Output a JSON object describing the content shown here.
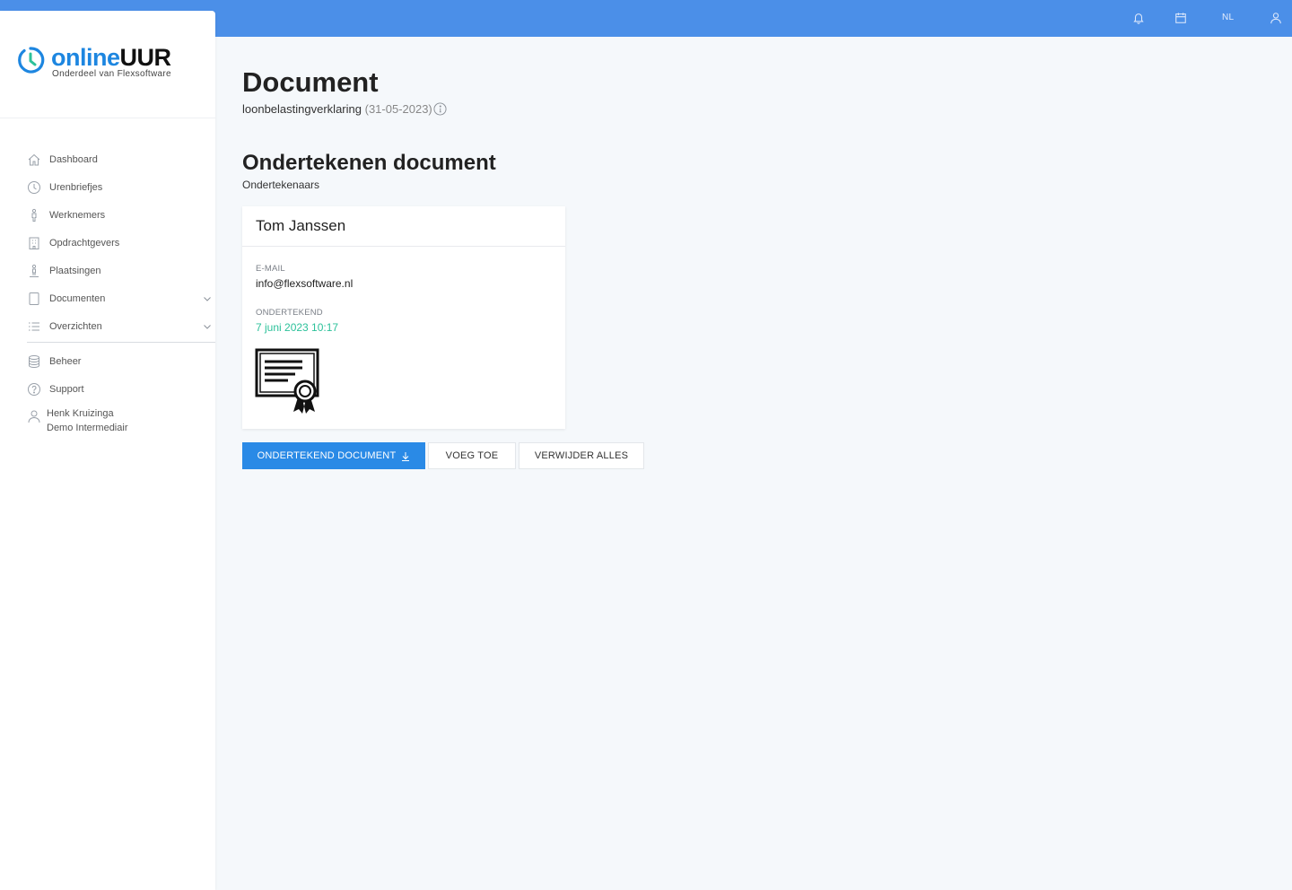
{
  "topbar": {
    "bell_icon": "bell-icon",
    "calendar_icon": "calendar-icon",
    "language": "NL",
    "user_icon": "user-icon",
    "color": "#4b8fe8"
  },
  "brand": {
    "name_part1": "online",
    "name_part2": "UUR",
    "tagline": "Onderdeel van Flexsoftware",
    "accent": "#1d86e0"
  },
  "sidebar": {
    "items": [
      {
        "label": "Dashboard",
        "icon": "home-icon"
      },
      {
        "label": "Urenbriefjes",
        "icon": "clock-icon"
      },
      {
        "label": "Werknemers",
        "icon": "person-icon"
      },
      {
        "label": "Opdrachtgevers",
        "icon": "building-icon"
      },
      {
        "label": "Plaatsingen",
        "icon": "placement-icon"
      },
      {
        "label": "Documenten",
        "icon": "document-icon",
        "expandable": true
      },
      {
        "label": "Overzichten",
        "icon": "list-icon",
        "expandable": true
      }
    ],
    "secondary": [
      {
        "label": "Beheer",
        "icon": "database-icon"
      },
      {
        "label": "Support",
        "icon": "help-icon"
      }
    ],
    "user": {
      "name": "Henk Kruizinga",
      "role": "Demo Intermediair"
    }
  },
  "page": {
    "title": "Document",
    "document_name": "loonbelastingverklaring",
    "document_date": "(31-05-2023)"
  },
  "sign_section": {
    "title": "Ondertekenen document",
    "subtitle": "Ondertekenaars"
  },
  "signer": {
    "name": "Tom Janssen",
    "email_label": "E-MAIL",
    "email": "info@flexsoftware.nl",
    "signed_label": "ONDERTEKEND",
    "signed_at": "7 juni 2023 10:17",
    "signed_color": "#2cc19a"
  },
  "actions": {
    "primary": "ONDERTEKEND DOCUMENT",
    "add": "VOEG TOE",
    "remove_all": "VERWIJDER ALLES"
  }
}
